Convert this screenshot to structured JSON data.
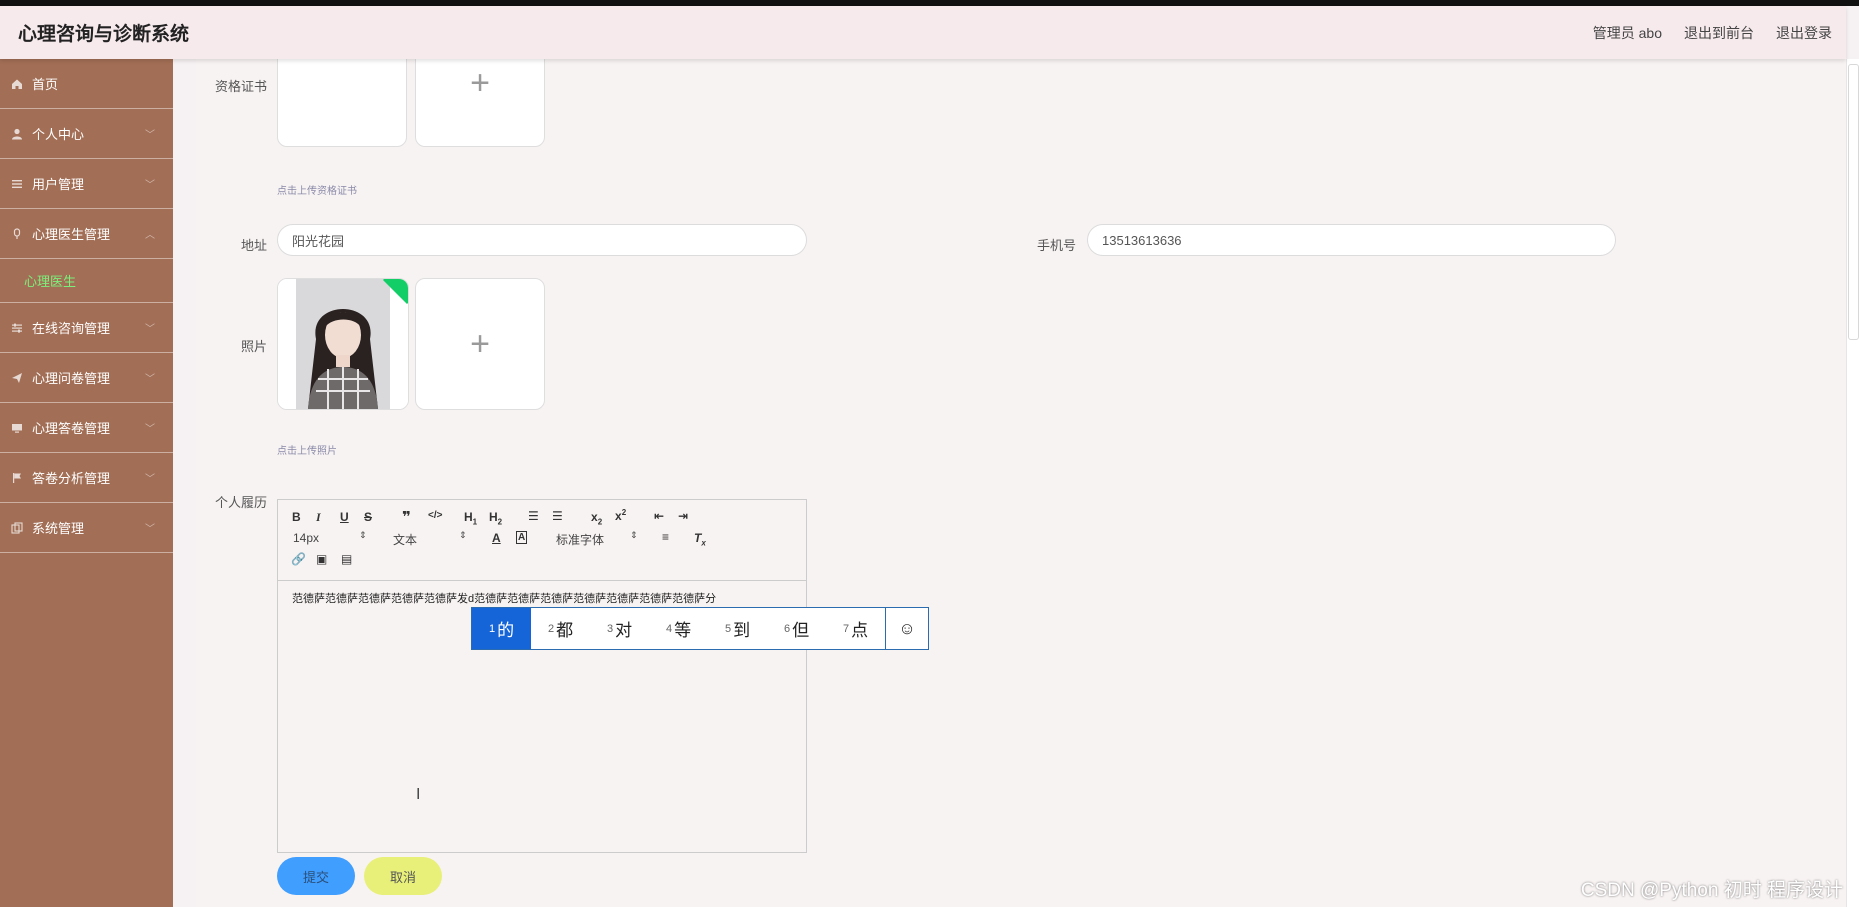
{
  "app": {
    "title": "心理咨询与诊断系统"
  },
  "header": {
    "user_label": "管理员 abo",
    "to_front": "退出到前台",
    "logout": "退出登录"
  },
  "sidebar": {
    "items": [
      {
        "label": "首页",
        "icon": "home-icon"
      },
      {
        "label": "个人中心",
        "icon": "user-icon"
      },
      {
        "label": "用户管理",
        "icon": "list-icon"
      },
      {
        "label": "心理医生管理",
        "icon": "doctor-icon",
        "submenu": "心理医生"
      },
      {
        "label": "在线咨询管理",
        "icon": "sliders-icon"
      },
      {
        "label": "心理问卷管理",
        "icon": "send-icon"
      },
      {
        "label": "心理答卷管理",
        "icon": "monitor-icon"
      },
      {
        "label": "答卷分析管理",
        "icon": "flag-icon"
      },
      {
        "label": "系统管理",
        "icon": "copy-icon"
      }
    ]
  },
  "form": {
    "certificate_label": "资格证书",
    "certificate_hint": "点击上传资格证书",
    "address_label": "地址",
    "address_value": "阳光花园",
    "phone_label": "手机号",
    "phone_value": "13513613636",
    "photo_label": "照片",
    "photo_hint": "点击上传照片",
    "resume_label": "个人履历",
    "editor": {
      "font_size": "14px",
      "block_format": "文本",
      "font_family": "标准字体",
      "content": "范德萨范德萨范德萨范德萨范德萨发d范德萨范德萨范德萨范德萨范德萨范德萨范德萨分"
    },
    "submit": "提交",
    "cancel": "取消"
  },
  "ime": {
    "candidates": [
      {
        "n": "1",
        "c": "的"
      },
      {
        "n": "2",
        "c": "都"
      },
      {
        "n": "3",
        "c": "对"
      },
      {
        "n": "4",
        "c": "等"
      },
      {
        "n": "5",
        "c": "到"
      },
      {
        "n": "6",
        "c": "但"
      },
      {
        "n": "7",
        "c": "点"
      }
    ]
  },
  "watermark": "CSDN @Python 初时 程序设计"
}
